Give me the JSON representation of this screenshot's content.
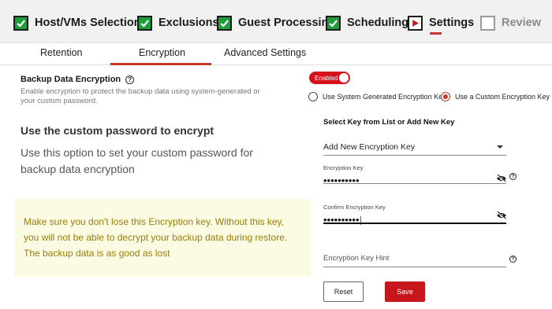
{
  "wizard": {
    "steps": [
      {
        "label": "Host/VMs Selection",
        "state": "done"
      },
      {
        "label": "Exclusions",
        "state": "done"
      },
      {
        "label": "Guest Processing",
        "state": "done"
      },
      {
        "label": "Scheduling",
        "state": "done"
      },
      {
        "label": "Settings",
        "state": "current"
      },
      {
        "label": "Review",
        "state": "pending"
      }
    ]
  },
  "tabs": {
    "retention": "Retention",
    "encryption": "Encryption",
    "advanced": "Advanced Settings",
    "active": "Encryption"
  },
  "encryption": {
    "title": "Backup Data Encryption",
    "help_glyph": "?",
    "description": "Enable encryption to protect the backup data using system-generated or your custom password.",
    "toggle_label": "Enabled",
    "toggle_on": true,
    "option_system": "Use System Generated Encryption Key",
    "option_custom": "Use a Custom Encryption Key",
    "selected_option": "custom"
  },
  "info": {
    "heading": "Use the custom password to encrypt",
    "subtext": "Use this option to set your custom password for backup data encryption",
    "warning_line1": "Make sure you don't lose this Encryption key. Without this key,",
    "warning_line2": "you will not be able to decrypt your backup  data during restore.",
    "warning_line3": "The backup data is as good as lost"
  },
  "form": {
    "select_label": "Select Key from List or Add New Key",
    "select_value": "Add New Encryption Key",
    "key_label": "Encryption Key",
    "key_value": "••••••••••",
    "confirm_label": "Confirm Encryption Key",
    "confirm_value": "••••••••••",
    "hint_placeholder": "Encryption Key Hint",
    "reset_label": "Reset",
    "save_label": "Save"
  },
  "colors": {
    "accent_red": "#c8161d",
    "check_green": "#1f9d3a",
    "warning_bg": "#fbfbe3",
    "warning_text": "#9a7d0a"
  }
}
